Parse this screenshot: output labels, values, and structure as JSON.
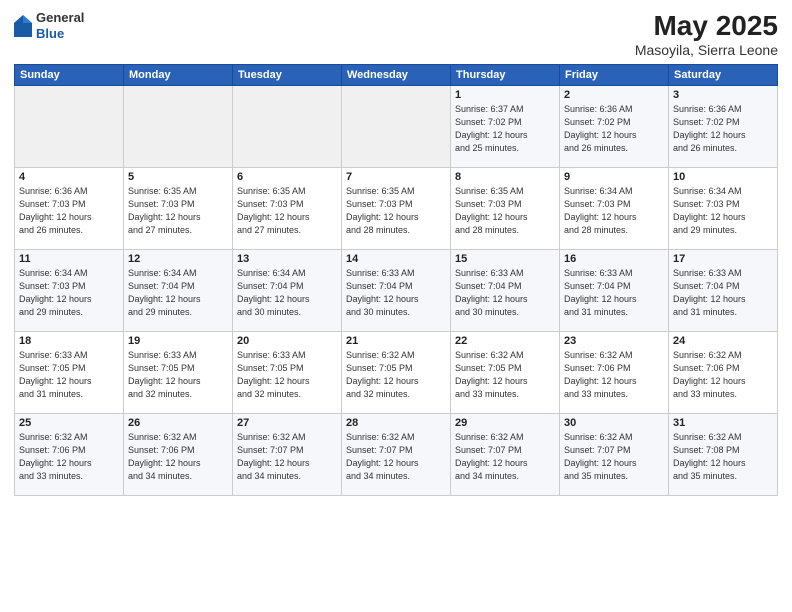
{
  "logo": {
    "general": "General",
    "blue": "Blue"
  },
  "title": "May 2025",
  "subtitle": "Masoyila, Sierra Leone",
  "header": {
    "days": [
      "Sunday",
      "Monday",
      "Tuesday",
      "Wednesday",
      "Thursday",
      "Friday",
      "Saturday"
    ]
  },
  "weeks": [
    [
      {
        "day": "",
        "info": ""
      },
      {
        "day": "",
        "info": ""
      },
      {
        "day": "",
        "info": ""
      },
      {
        "day": "",
        "info": ""
      },
      {
        "day": "1",
        "info": "Sunrise: 6:37 AM\nSunset: 7:02 PM\nDaylight: 12 hours\nand 25 minutes."
      },
      {
        "day": "2",
        "info": "Sunrise: 6:36 AM\nSunset: 7:02 PM\nDaylight: 12 hours\nand 26 minutes."
      },
      {
        "day": "3",
        "info": "Sunrise: 6:36 AM\nSunset: 7:02 PM\nDaylight: 12 hours\nand 26 minutes."
      }
    ],
    [
      {
        "day": "4",
        "info": "Sunrise: 6:36 AM\nSunset: 7:03 PM\nDaylight: 12 hours\nand 26 minutes."
      },
      {
        "day": "5",
        "info": "Sunrise: 6:35 AM\nSunset: 7:03 PM\nDaylight: 12 hours\nand 27 minutes."
      },
      {
        "day": "6",
        "info": "Sunrise: 6:35 AM\nSunset: 7:03 PM\nDaylight: 12 hours\nand 27 minutes."
      },
      {
        "day": "7",
        "info": "Sunrise: 6:35 AM\nSunset: 7:03 PM\nDaylight: 12 hours\nand 28 minutes."
      },
      {
        "day": "8",
        "info": "Sunrise: 6:35 AM\nSunset: 7:03 PM\nDaylight: 12 hours\nand 28 minutes."
      },
      {
        "day": "9",
        "info": "Sunrise: 6:34 AM\nSunset: 7:03 PM\nDaylight: 12 hours\nand 28 minutes."
      },
      {
        "day": "10",
        "info": "Sunrise: 6:34 AM\nSunset: 7:03 PM\nDaylight: 12 hours\nand 29 minutes."
      }
    ],
    [
      {
        "day": "11",
        "info": "Sunrise: 6:34 AM\nSunset: 7:03 PM\nDaylight: 12 hours\nand 29 minutes."
      },
      {
        "day": "12",
        "info": "Sunrise: 6:34 AM\nSunset: 7:04 PM\nDaylight: 12 hours\nand 29 minutes."
      },
      {
        "day": "13",
        "info": "Sunrise: 6:34 AM\nSunset: 7:04 PM\nDaylight: 12 hours\nand 30 minutes."
      },
      {
        "day": "14",
        "info": "Sunrise: 6:33 AM\nSunset: 7:04 PM\nDaylight: 12 hours\nand 30 minutes."
      },
      {
        "day": "15",
        "info": "Sunrise: 6:33 AM\nSunset: 7:04 PM\nDaylight: 12 hours\nand 30 minutes."
      },
      {
        "day": "16",
        "info": "Sunrise: 6:33 AM\nSunset: 7:04 PM\nDaylight: 12 hours\nand 31 minutes."
      },
      {
        "day": "17",
        "info": "Sunrise: 6:33 AM\nSunset: 7:04 PM\nDaylight: 12 hours\nand 31 minutes."
      }
    ],
    [
      {
        "day": "18",
        "info": "Sunrise: 6:33 AM\nSunset: 7:05 PM\nDaylight: 12 hours\nand 31 minutes."
      },
      {
        "day": "19",
        "info": "Sunrise: 6:33 AM\nSunset: 7:05 PM\nDaylight: 12 hours\nand 32 minutes."
      },
      {
        "day": "20",
        "info": "Sunrise: 6:33 AM\nSunset: 7:05 PM\nDaylight: 12 hours\nand 32 minutes."
      },
      {
        "day": "21",
        "info": "Sunrise: 6:32 AM\nSunset: 7:05 PM\nDaylight: 12 hours\nand 32 minutes."
      },
      {
        "day": "22",
        "info": "Sunrise: 6:32 AM\nSunset: 7:05 PM\nDaylight: 12 hours\nand 33 minutes."
      },
      {
        "day": "23",
        "info": "Sunrise: 6:32 AM\nSunset: 7:06 PM\nDaylight: 12 hours\nand 33 minutes."
      },
      {
        "day": "24",
        "info": "Sunrise: 6:32 AM\nSunset: 7:06 PM\nDaylight: 12 hours\nand 33 minutes."
      }
    ],
    [
      {
        "day": "25",
        "info": "Sunrise: 6:32 AM\nSunset: 7:06 PM\nDaylight: 12 hours\nand 33 minutes."
      },
      {
        "day": "26",
        "info": "Sunrise: 6:32 AM\nSunset: 7:06 PM\nDaylight: 12 hours\nand 34 minutes."
      },
      {
        "day": "27",
        "info": "Sunrise: 6:32 AM\nSunset: 7:07 PM\nDaylight: 12 hours\nand 34 minutes."
      },
      {
        "day": "28",
        "info": "Sunrise: 6:32 AM\nSunset: 7:07 PM\nDaylight: 12 hours\nand 34 minutes."
      },
      {
        "day": "29",
        "info": "Sunrise: 6:32 AM\nSunset: 7:07 PM\nDaylight: 12 hours\nand 34 minutes."
      },
      {
        "day": "30",
        "info": "Sunrise: 6:32 AM\nSunset: 7:07 PM\nDaylight: 12 hours\nand 35 minutes."
      },
      {
        "day": "31",
        "info": "Sunrise: 6:32 AM\nSunset: 7:08 PM\nDaylight: 12 hours\nand 35 minutes."
      }
    ]
  ]
}
